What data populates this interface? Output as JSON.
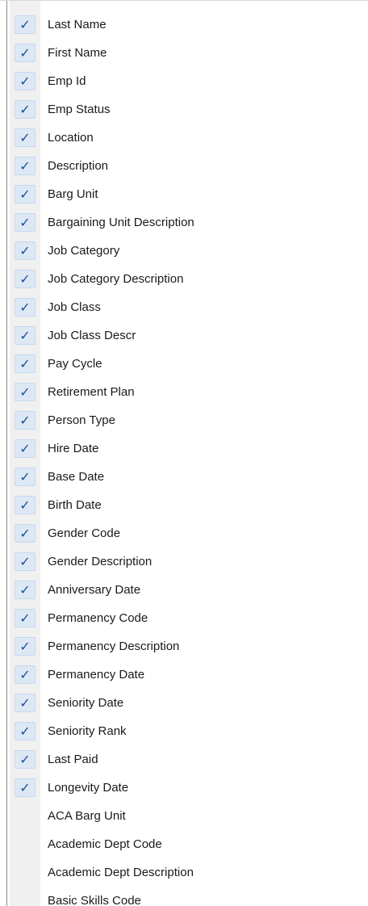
{
  "colors": {
    "gutter": "#f0f0f0",
    "check_highlight": "#dde8f5",
    "check_mark": "#1f4e9a",
    "text": "#1a1a1a"
  },
  "check_glyph": "✓",
  "items": [
    {
      "label": "Last Name",
      "checked": true
    },
    {
      "label": "First Name",
      "checked": true
    },
    {
      "label": "Emp Id",
      "checked": true
    },
    {
      "label": "Emp Status",
      "checked": true
    },
    {
      "label": "Location",
      "checked": true
    },
    {
      "label": "Description",
      "checked": true
    },
    {
      "label": "Barg Unit",
      "checked": true
    },
    {
      "label": "Bargaining Unit Description",
      "checked": true
    },
    {
      "label": "Job Category",
      "checked": true
    },
    {
      "label": "Job Category Description",
      "checked": true
    },
    {
      "label": "Job Class",
      "checked": true
    },
    {
      "label": "Job Class Descr",
      "checked": true
    },
    {
      "label": "Pay Cycle",
      "checked": true
    },
    {
      "label": "Retirement Plan",
      "checked": true
    },
    {
      "label": "Person Type",
      "checked": true
    },
    {
      "label": "Hire Date",
      "checked": true
    },
    {
      "label": "Base Date",
      "checked": true
    },
    {
      "label": "Birth Date",
      "checked": true
    },
    {
      "label": "Gender Code",
      "checked": true
    },
    {
      "label": "Gender Description",
      "checked": true
    },
    {
      "label": "Anniversary Date",
      "checked": true
    },
    {
      "label": "Permanency Code",
      "checked": true
    },
    {
      "label": "Permanency Description",
      "checked": true
    },
    {
      "label": "Permanency Date",
      "checked": true
    },
    {
      "label": "Seniority Date",
      "checked": true
    },
    {
      "label": "Seniority Rank",
      "checked": true
    },
    {
      "label": "Last Paid",
      "checked": true
    },
    {
      "label": "Longevity Date",
      "checked": true
    },
    {
      "label": "ACA Barg Unit",
      "checked": false
    },
    {
      "label": "Academic Dept Code",
      "checked": false
    },
    {
      "label": "Academic Dept Description",
      "checked": false
    },
    {
      "label": "Basic Skills Code",
      "checked": false
    }
  ]
}
